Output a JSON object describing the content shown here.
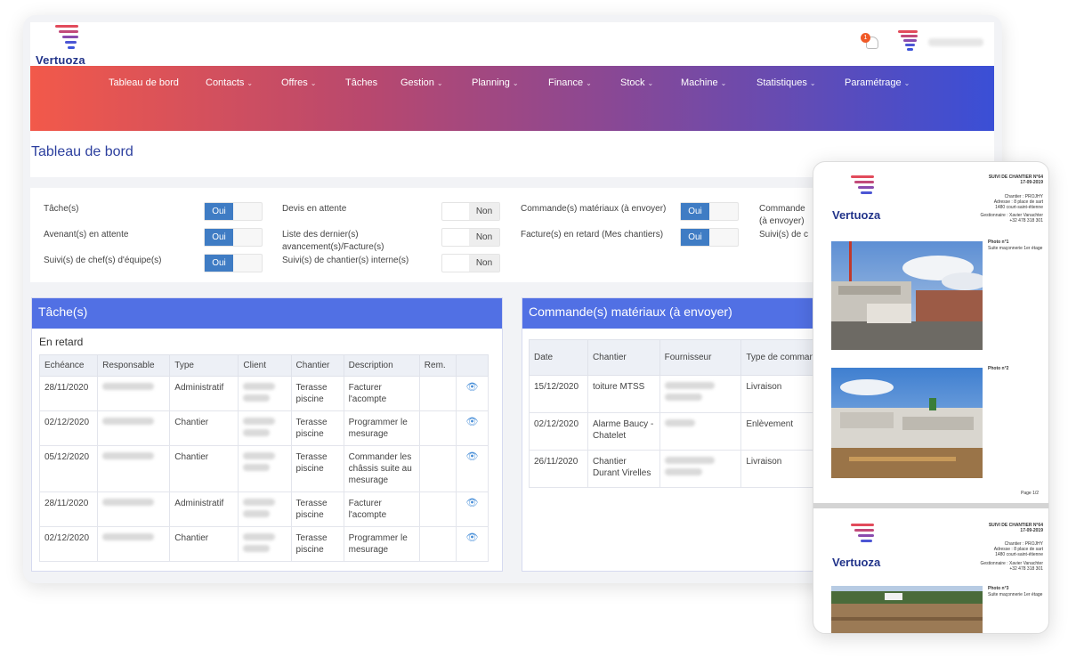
{
  "app": {
    "brand": "Vertuoza",
    "notification_count": "1"
  },
  "nav": {
    "items": [
      {
        "label": "Tableau de bord",
        "dropdown": false
      },
      {
        "label": "Contacts",
        "dropdown": true
      },
      {
        "label": "Offres",
        "dropdown": true
      },
      {
        "label": "Tâches",
        "dropdown": false
      },
      {
        "label": "Gestion",
        "dropdown": true
      },
      {
        "label": "Planning",
        "dropdown": true
      },
      {
        "label": "Finance",
        "dropdown": true
      },
      {
        "label": "Stock",
        "dropdown": true
      },
      {
        "label": "Machine",
        "dropdown": true
      },
      {
        "label": "Statistiques",
        "dropdown": true
      },
      {
        "label": "Paramétrage",
        "dropdown": true
      }
    ],
    "chevron": "⌄"
  },
  "page": {
    "title": "Tableau de bord"
  },
  "filters": {
    "yes": "Oui",
    "no": "Non",
    "col1": [
      {
        "label": "Tâche(s)",
        "state": "Oui"
      },
      {
        "label": "Avenant(s) en attente",
        "state": "Oui"
      },
      {
        "label": "Suivi(s) de chef(s) d'équipe(s)",
        "state": "Oui"
      }
    ],
    "col2": [
      {
        "label": "Devis en attente",
        "state": "Non"
      },
      {
        "label": "Liste des dernier(s) avancement(s)/Facture(s)",
        "state": "Non"
      },
      {
        "label": "Suivi(s) de chantier(s) interne(s)",
        "state": "Non"
      }
    ],
    "col3": [
      {
        "label": "Commande(s) matériaux (à envoyer)",
        "state": "Oui"
      },
      {
        "label": "Facture(s) en retard (Mes chantiers)",
        "state": "Oui"
      }
    ],
    "col4": [
      {
        "label": "Commande"
      },
      {
        "label": "(à envoyer)"
      },
      {
        "label": "Suivi(s) de c"
      }
    ]
  },
  "tasks_card": {
    "title": "Tâche(s)",
    "subtitle": "En retard",
    "columns": [
      "Echéance",
      "Responsable",
      "Type",
      "Client",
      "Chantier",
      "Description",
      "Rem.",
      ""
    ],
    "rows": [
      {
        "date": "28/11/2020",
        "type": "Administratif",
        "chantier": "Terasse piscine",
        "description": "Facturer l'acompte"
      },
      {
        "date": "02/12/2020",
        "type": "Chantier",
        "chantier": "Terasse piscine",
        "description": "Programmer le mesurage"
      },
      {
        "date": "05/12/2020",
        "type": "Chantier",
        "chantier": "Terasse piscine",
        "description": "Commander les châssis suite au mesurage"
      },
      {
        "date": "28/11/2020",
        "type": "Administratif",
        "chantier": "Terasse piscine",
        "description": "Facturer l'acompte"
      },
      {
        "date": "02/12/2020",
        "type": "Chantier",
        "chantier": "Terasse piscine",
        "description": "Programmer le mesurage"
      }
    ],
    "eye_icon": "👁"
  },
  "orders_card": {
    "title": "Commande(s) matériaux (à envoyer)",
    "columns": [
      "Date",
      "Chantier",
      "Fournisseur",
      "Type de commande"
    ],
    "rows": [
      {
        "date": "15/12/2020",
        "chantier": "toiture MTSS",
        "type": "Livraison"
      },
      {
        "date": "02/12/2020",
        "chantier": "Alarme Baucy - Chatelet",
        "type": "Enlèvement"
      },
      {
        "date": "26/11/2020",
        "chantier": "Chantier Durant Virelles",
        "type": "Livraison"
      }
    ]
  },
  "phone": {
    "page1": {
      "report_title": "SUIVI DE CHANTIER N°64",
      "report_date": "17-09-2019",
      "info_lines": [
        "Chantier : PROJHY",
        "Adresse : 8 place de sart",
        "1480 court-saint-étienne"
      ],
      "manager_lines": [
        "Gestionnaire : Xavier Vanachter",
        "+32 478 318 301"
      ],
      "photo1_title": "Photo n°1",
      "photo1_caption": "Suite maçonnerie 1er étage",
      "photo2_title": "Photo n°2",
      "page_number": "Page 1/2"
    },
    "page2": {
      "report_title": "SUIVI DE CHANTIER N°64",
      "report_date": "17-09-2019",
      "info_lines": [
        "Chantier : PROJHY",
        "Adresse : 8 place de sart",
        "1480 court-saint-étienne"
      ],
      "manager_lines": [
        "Gestionnaire : Xavier Vanachter",
        "+32 478 318 301"
      ],
      "photo1_title": "Photo n°3",
      "photo1_caption": "Suite maçonnerie 1er étage"
    }
  },
  "colors": {
    "brand_navy": "#22348a",
    "card_header": "#5170e4",
    "toggle_on": "#3f7cc4",
    "nav_start": "#f2594a",
    "nav_end": "#3a4fd6"
  }
}
